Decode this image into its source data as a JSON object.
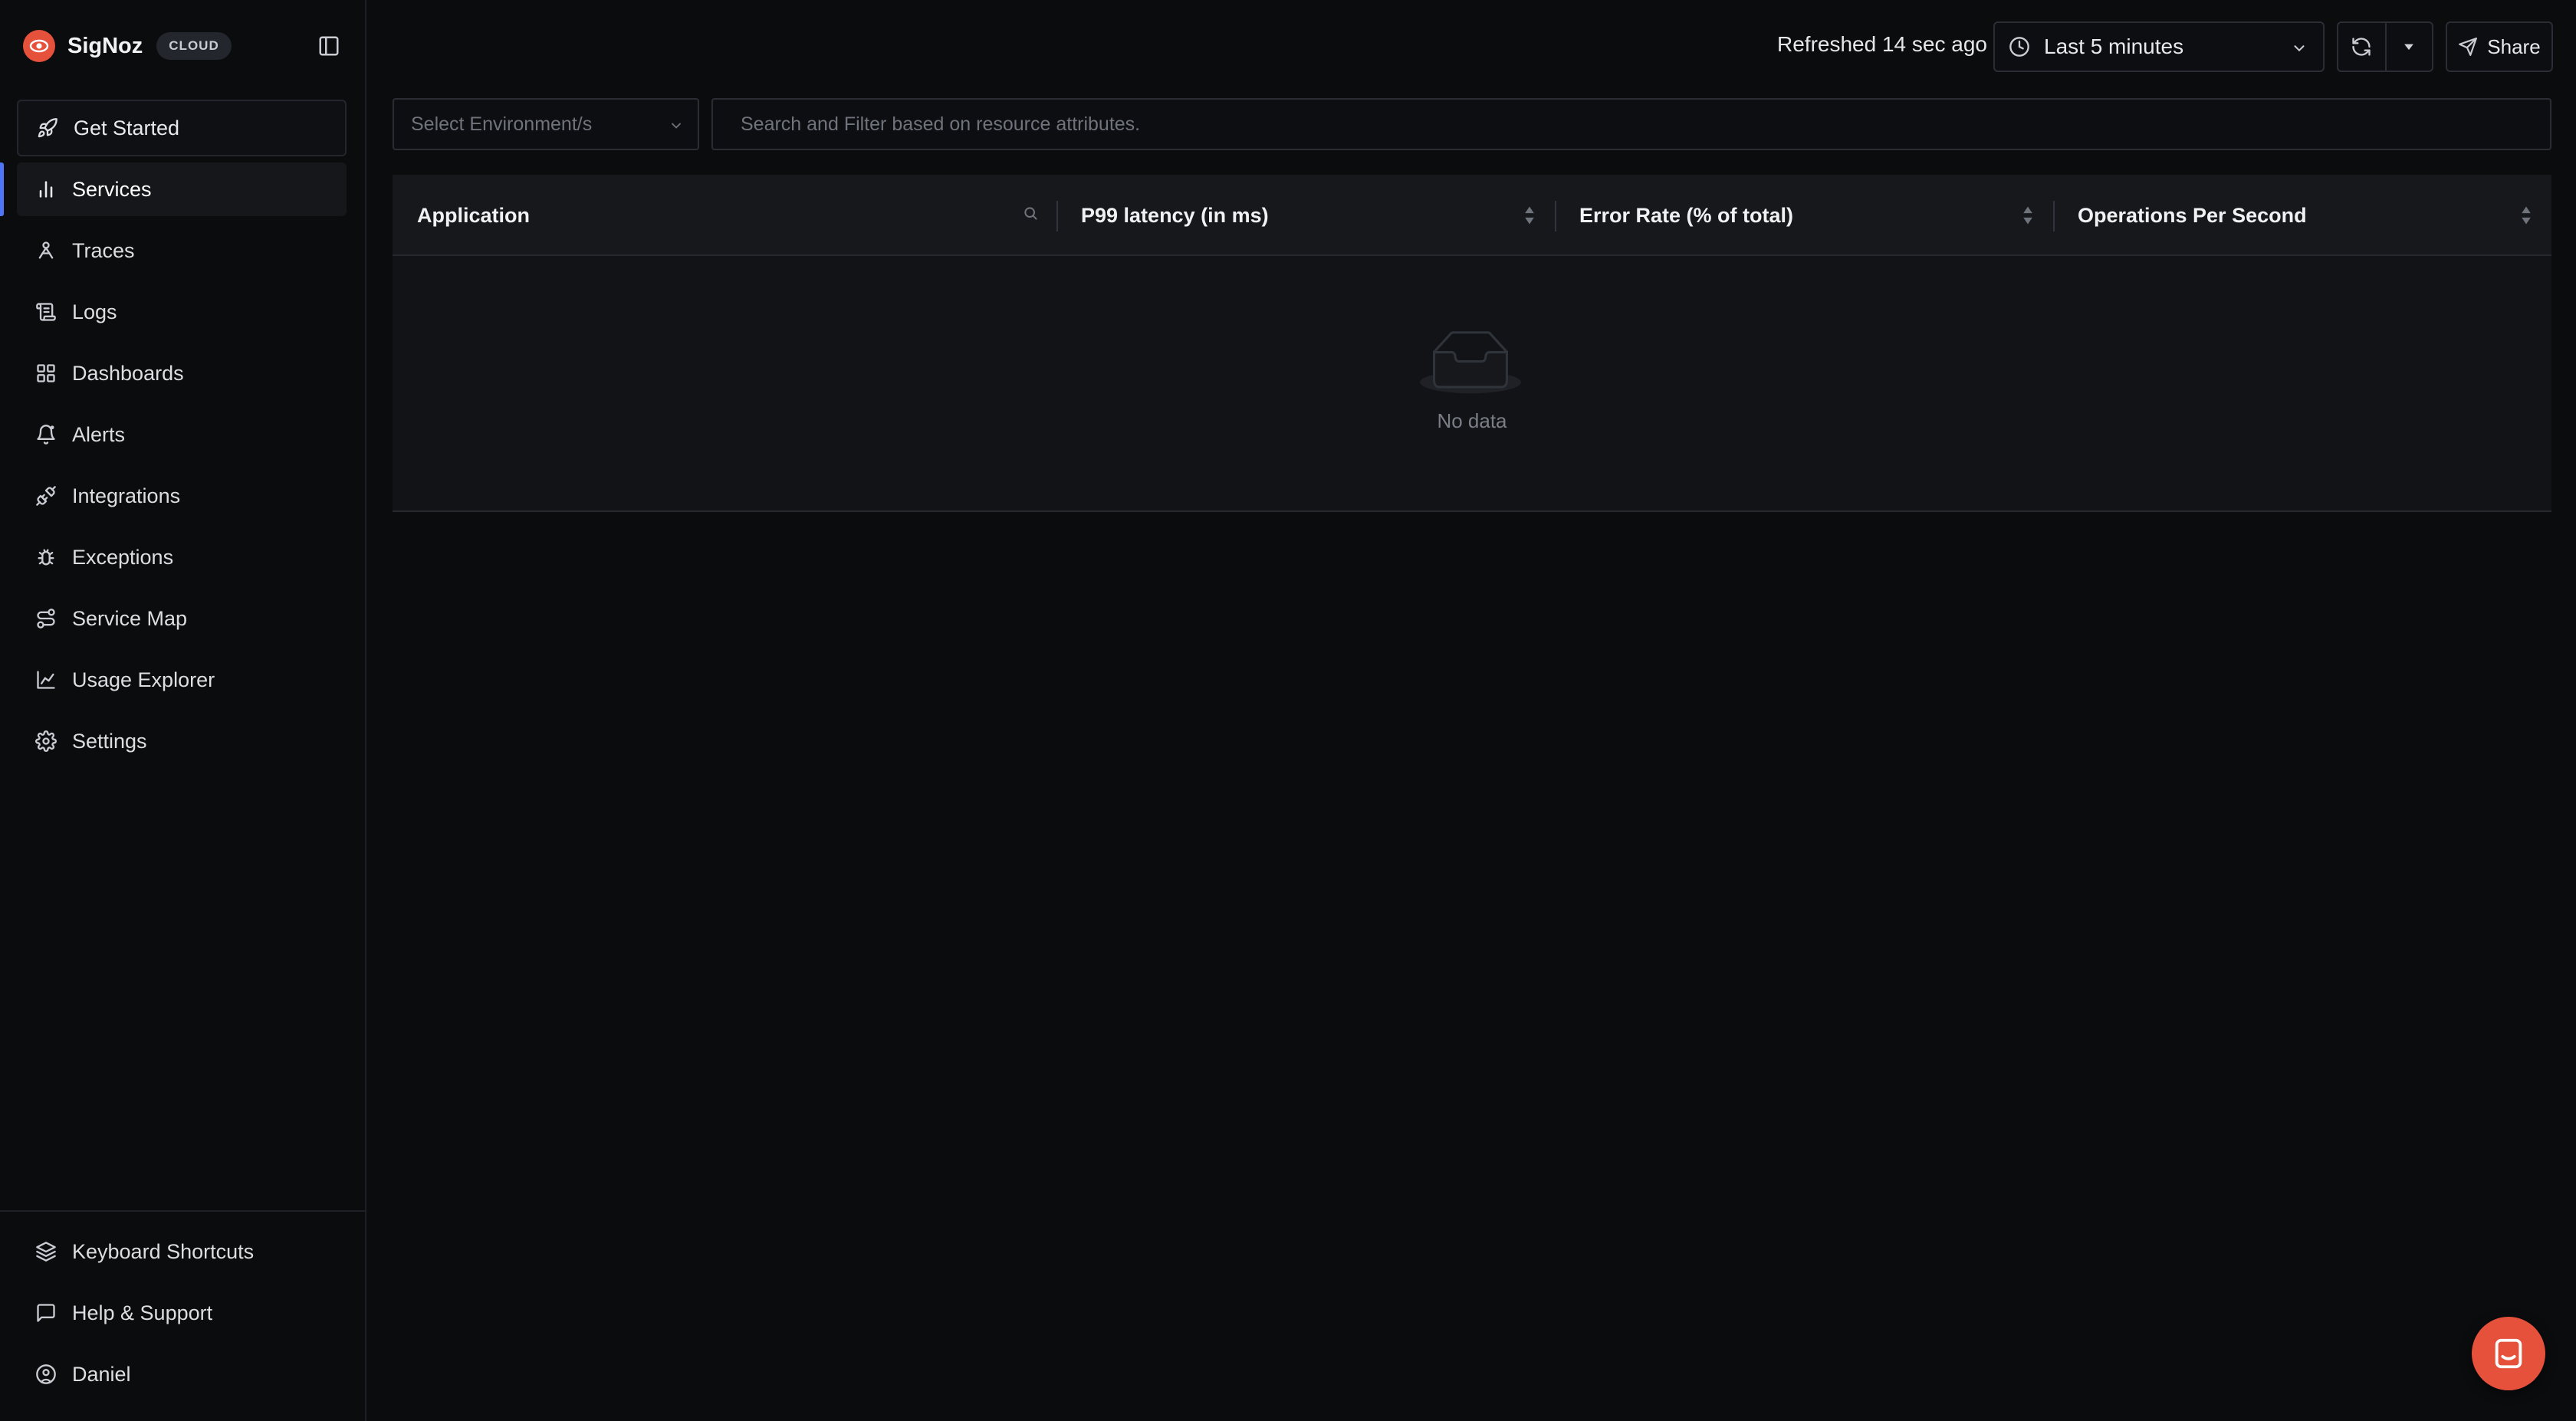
{
  "brand": {
    "name": "SigNoz",
    "badge": "CLOUD"
  },
  "nav": {
    "get_started": "Get Started",
    "items": [
      {
        "label": "Services",
        "icon": "bar-chart-icon",
        "active": true
      },
      {
        "label": "Traces",
        "icon": "traces-icon"
      },
      {
        "label": "Logs",
        "icon": "logs-icon"
      },
      {
        "label": "Dashboards",
        "icon": "dashboards-icon"
      },
      {
        "label": "Alerts",
        "icon": "bell-icon"
      },
      {
        "label": "Integrations",
        "icon": "plug-icon"
      },
      {
        "label": "Exceptions",
        "icon": "bug-icon"
      },
      {
        "label": "Service Map",
        "icon": "route-icon"
      },
      {
        "label": "Usage Explorer",
        "icon": "line-chart-icon"
      },
      {
        "label": "Settings",
        "icon": "gear-icon"
      }
    ],
    "bottom": [
      {
        "label": "Keyboard Shortcuts",
        "icon": "layers-icon"
      },
      {
        "label": "Help & Support",
        "icon": "message-square-icon"
      },
      {
        "label": "Daniel",
        "icon": "user-circle-icon"
      }
    ]
  },
  "topbar": {
    "refreshed_text": "Refreshed 14 sec ago",
    "time_range": "Last 5 minutes",
    "share_label": "Share"
  },
  "filters": {
    "environment_placeholder": "Select Environment/s",
    "search_placeholder": "Search and Filter based on resource attributes."
  },
  "table": {
    "columns": [
      "Application",
      "P99 latency (in ms)",
      "Error Rate (% of total)",
      "Operations Per Second"
    ],
    "empty_text": "No data"
  },
  "colors": {
    "accent": "#4e74f8",
    "brand": "#e5513b",
    "background": "#0b0c0e"
  }
}
